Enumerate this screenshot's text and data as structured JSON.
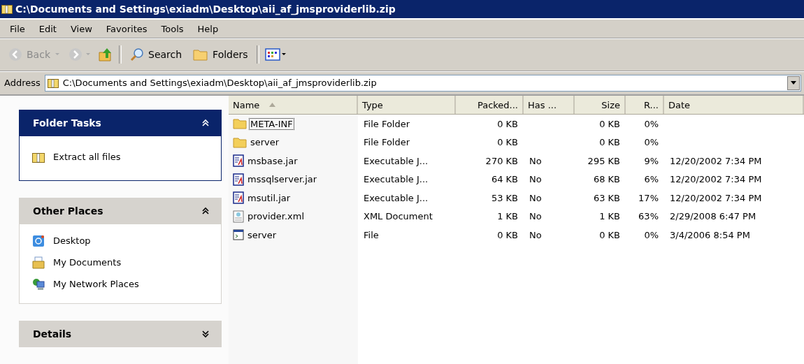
{
  "window": {
    "title": "C:\\Documents and Settings\\exiadm\\Desktop\\aii_af_jmsproviderlib.zip"
  },
  "menu": [
    "File",
    "Edit",
    "View",
    "Favorites",
    "Tools",
    "Help"
  ],
  "toolbar": {
    "back": "Back",
    "search": "Search",
    "folders": "Folders"
  },
  "address": {
    "label": "Address",
    "value": "C:\\Documents and Settings\\exiadm\\Desktop\\aii_af_jmsproviderlib.zip"
  },
  "sidebar": [
    {
      "title": "Folder Tasks",
      "kind": "special",
      "expanded": true,
      "items": [
        {
          "label": "Extract all files",
          "kind": "zip"
        }
      ]
    },
    {
      "title": "Other Places",
      "kind": "normal",
      "expanded": true,
      "items": [
        {
          "label": "Desktop",
          "kind": "desktop"
        },
        {
          "label": "My Documents",
          "kind": "documents"
        },
        {
          "label": "My Network Places",
          "kind": "network"
        }
      ]
    },
    {
      "title": "Details",
      "kind": "normal",
      "expanded": false
    }
  ],
  "table": {
    "columns": [
      "Name",
      "Type",
      "Packed...",
      "Has ...",
      "Size",
      "R...",
      "Date"
    ],
    "rows": [
      {
        "kind": "folder",
        "focused": true,
        "cells": [
          "META-INF",
          "File Folder",
          "0 KB",
          "",
          "0 KB",
          "0%",
          ""
        ]
      },
      {
        "kind": "folder",
        "focused": false,
        "cells": [
          "server",
          "File Folder",
          "0 KB",
          "",
          "0 KB",
          "0%",
          ""
        ]
      },
      {
        "kind": "jar",
        "focused": false,
        "cells": [
          "msbase.jar",
          "Executable J...",
          "270 KB",
          "No",
          "295 KB",
          "9%",
          "12/20/2002 7:34 PM"
        ]
      },
      {
        "kind": "jar",
        "focused": false,
        "cells": [
          "mssqlserver.jar",
          "Executable J...",
          "64 KB",
          "No",
          "68 KB",
          "6%",
          "12/20/2002 7:34 PM"
        ]
      },
      {
        "kind": "jar",
        "focused": false,
        "cells": [
          "msutil.jar",
          "Executable J...",
          "53 KB",
          "No",
          "63 KB",
          "17%",
          "12/20/2002 7:34 PM"
        ]
      },
      {
        "kind": "xml",
        "focused": false,
        "cells": [
          "provider.xml",
          "XML Document",
          "1 KB",
          "No",
          "1 KB",
          "63%",
          "2/29/2008 6:47 PM"
        ]
      },
      {
        "kind": "file",
        "focused": false,
        "cells": [
          "server",
          "File",
          "0 KB",
          "No",
          "0 KB",
          "0%",
          "3/4/2006 8:54 PM"
        ]
      }
    ]
  }
}
